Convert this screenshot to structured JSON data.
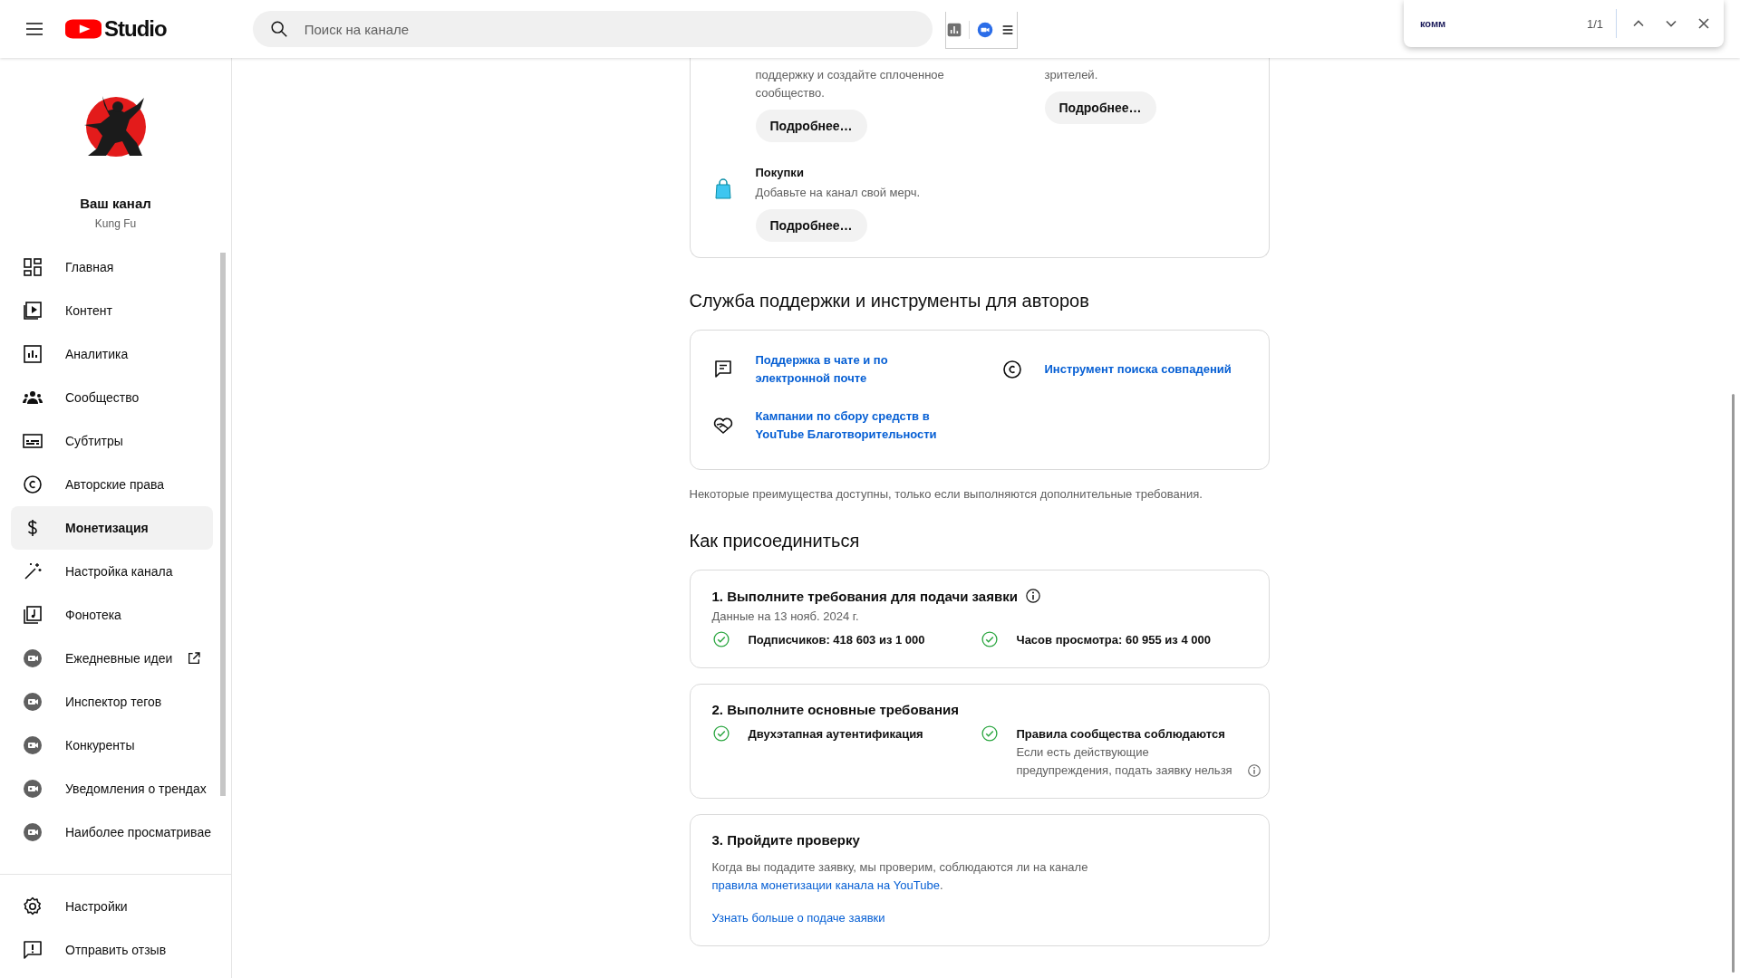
{
  "header": {
    "product": "Studio",
    "search": {
      "placeholder": "Поиск на канале"
    }
  },
  "find_bar": {
    "query": "комм",
    "count": "1/1"
  },
  "sidebar": {
    "channel": {
      "title": "Ваш канал",
      "name": "Kung Fu"
    },
    "items": [
      {
        "label": "Главная",
        "selected": false,
        "external": false
      },
      {
        "label": "Контент",
        "selected": false,
        "external": false
      },
      {
        "label": "Аналитика",
        "selected": false,
        "external": false
      },
      {
        "label": "Сообщество",
        "selected": false,
        "external": false
      },
      {
        "label": "Субтитры",
        "selected": false,
        "external": false
      },
      {
        "label": "Авторские права",
        "selected": false,
        "external": false
      },
      {
        "label": "Монетизация",
        "selected": true,
        "external": false
      },
      {
        "label": "Настройка канала",
        "selected": false,
        "external": false
      },
      {
        "label": "Фонотека",
        "selected": false,
        "external": false
      },
      {
        "label": "Ежедневные идеи",
        "selected": false,
        "external": true
      },
      {
        "label": "Инспектор тегов",
        "selected": false,
        "external": false
      },
      {
        "label": "Конкуренты",
        "selected": false,
        "external": false
      },
      {
        "label": "Уведомления о трендах",
        "selected": false,
        "external": false
      },
      {
        "label": "Наиболее просматривае",
        "selected": false,
        "external": false
      }
    ],
    "footer_items": [
      {
        "label": "Настройки"
      },
      {
        "label": "Отправить отзыв"
      }
    ]
  },
  "benefits": [
    {
      "description": "поддержку и создайте сплоченное сообщество.",
      "button": "Подробнее…"
    },
    {
      "description": "зрителей.",
      "button": "Подробнее…"
    },
    {
      "title": "Покупки",
      "description": "Добавьте на канал свой мерч.",
      "button": "Подробнее…"
    }
  ],
  "support": {
    "title": "Служба поддержки и инструменты для авторов",
    "links": [
      "Поддержка в чате и по электронной почте",
      "Инструмент поиска совпадений",
      "Кампании по сбору средств в YouTube Благотворительности"
    ]
  },
  "note": "Некоторые преимущества доступны, только если выполняются дополнительные требования.",
  "join": {
    "title": "Как присоединиться",
    "steps": [
      {
        "title": "1. Выполните требования для подачи заявки",
        "info": true,
        "subtitle": "Данные на 13 нояб. 2024 г.",
        "checks": [
          {
            "label": "Подписчиков: 418 603 из 1 000",
            "done": true
          },
          {
            "label": "Часов просмотра: 60 955 из 4 000",
            "done": true
          }
        ]
      },
      {
        "title": "2. Выполните основные требования",
        "info": false,
        "checks": [
          {
            "label": "Двухэтапная аутентификация",
            "done": true
          },
          {
            "label": "Правила сообщества соблюдаются",
            "done": true,
            "detail": "Если есть действующие предупреждения, подать заявку нельзя",
            "detail_info": true
          }
        ]
      },
      {
        "title": "3. Пройдите проверку",
        "info": false,
        "text": "Когда вы подадите заявку, мы проверим, соблюдаются ли на канале",
        "link": "правила монетизации канала на YouTube",
        "text_end": ".",
        "more_link": "Узнать больше о подаче заявки"
      }
    ]
  }
}
